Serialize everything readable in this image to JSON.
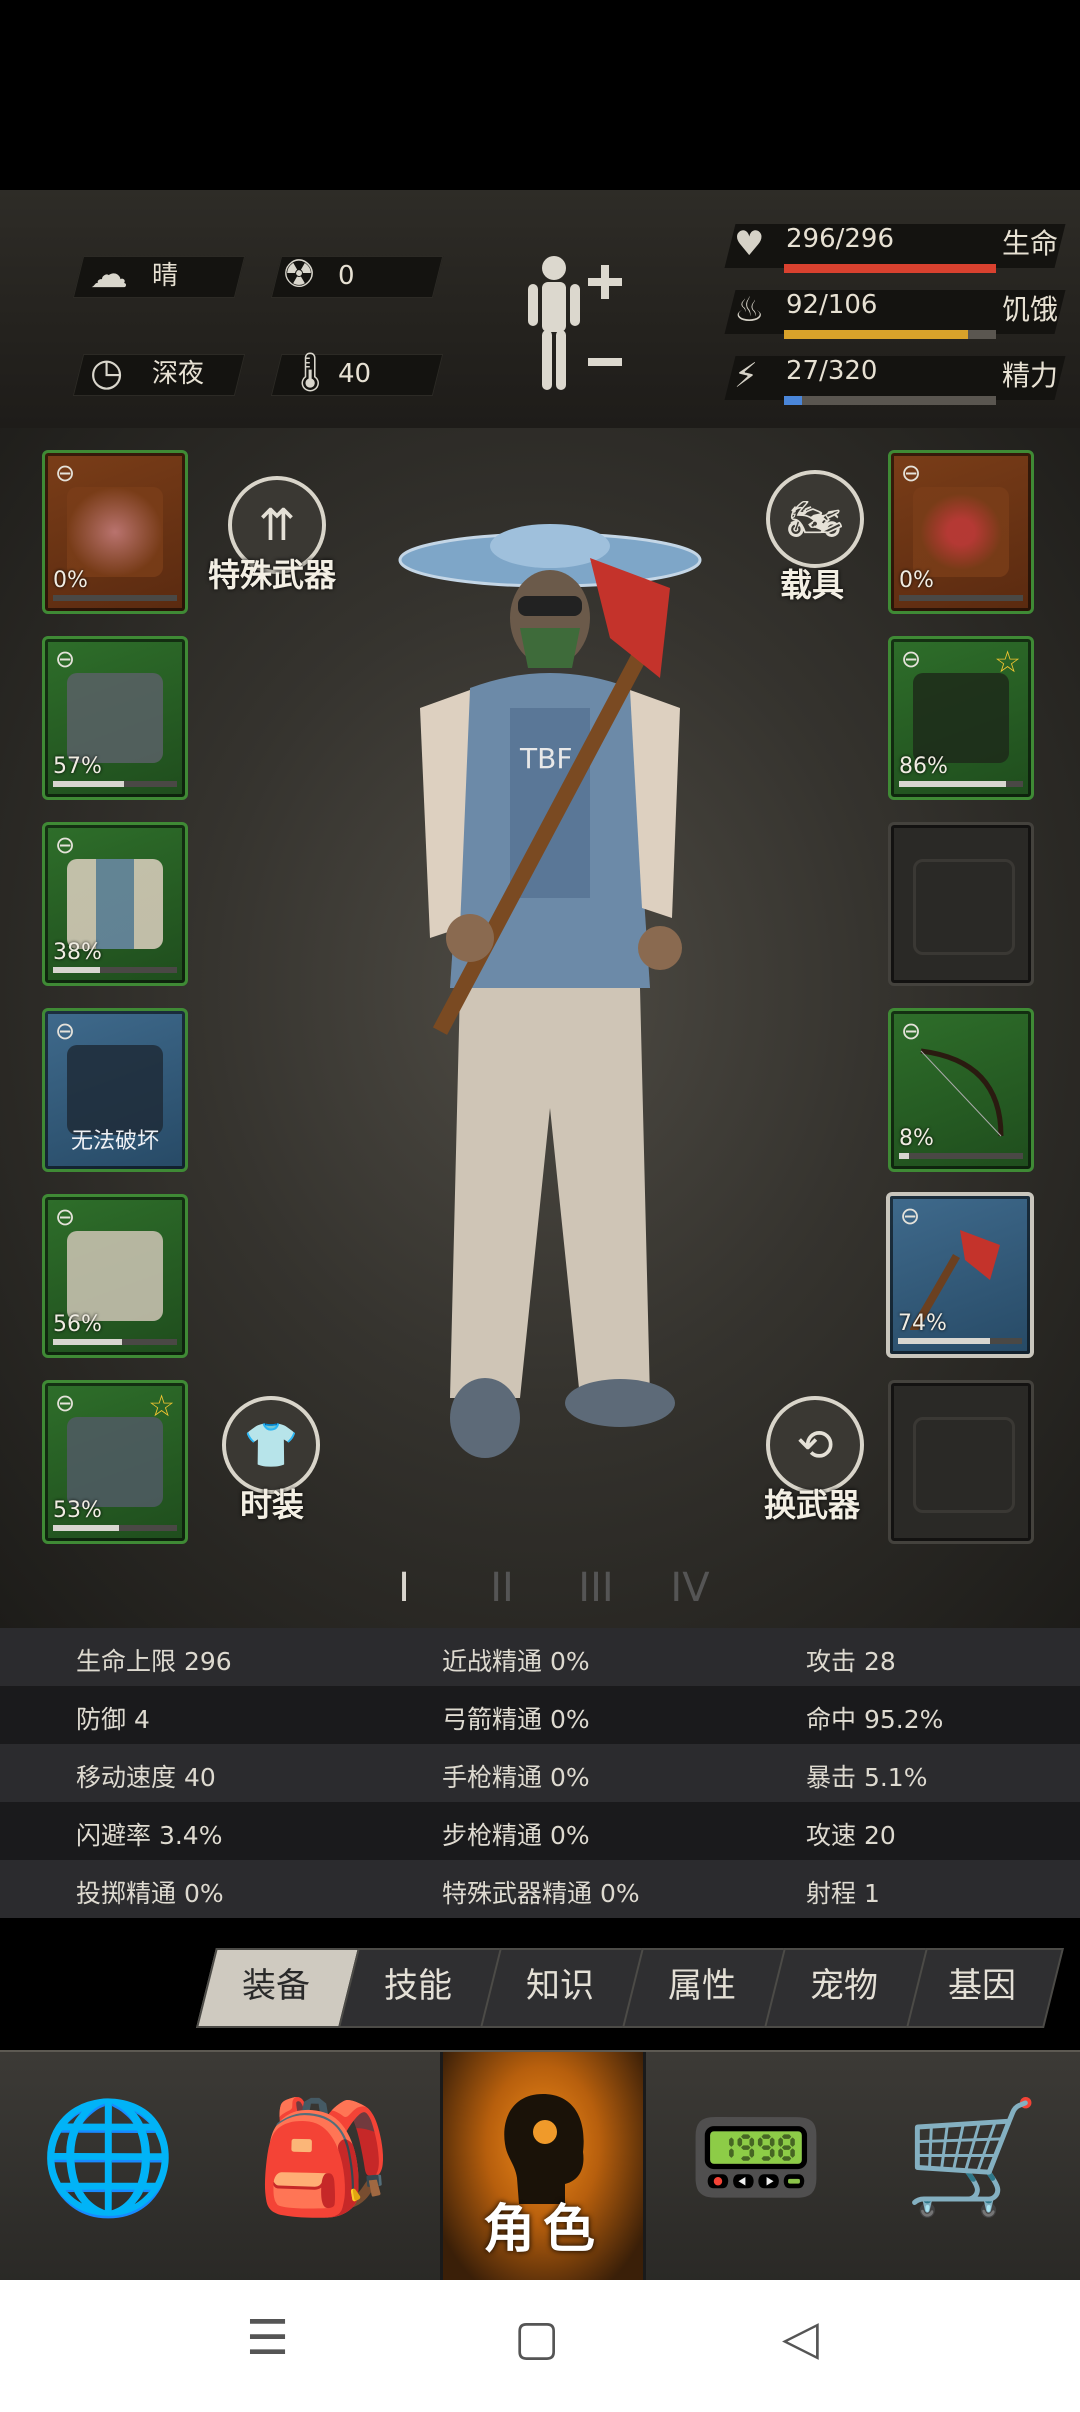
{
  "status": {
    "weather": "晴",
    "radiation": "0",
    "time_of_day": "深夜",
    "temperature": "40"
  },
  "vitals": [
    {
      "value": "296/296",
      "name": "生命",
      "fill": 1.0,
      "color": "#d9412f",
      "icon": "heart-icon"
    },
    {
      "value": "92/106",
      "name": "饥饿",
      "fill": 0.868,
      "color": "#d9a22a",
      "icon": "stomach-icon"
    },
    {
      "value": "27/320",
      "name": "精力",
      "fill": 0.084,
      "color": "#4a86d9",
      "icon": "energy-icon"
    }
  ],
  "left_slots": [
    {
      "type": "hat",
      "pct": "0%",
      "fill": 0.0
    },
    {
      "type": "shirt",
      "pct": "57%",
      "fill": 0.57
    },
    {
      "type": "jacket",
      "pct": "38%",
      "fill": 0.38
    },
    {
      "type": "backpack",
      "note": "无法破坏"
    },
    {
      "type": "pants",
      "pct": "56%",
      "fill": 0.56
    },
    {
      "type": "shoes",
      "pct": "53%",
      "fill": 0.53
    }
  ],
  "right_slots": [
    {
      "type": "glasses",
      "pct": "0%",
      "fill": 0.0
    },
    {
      "type": "mask",
      "pct": "86%",
      "fill": 0.86
    },
    {
      "type": "empty-bag"
    },
    {
      "type": "bow",
      "pct": "8%",
      "fill": 0.08
    },
    {
      "type": "axe",
      "pct": "74%",
      "fill": 0.74
    },
    {
      "type": "empty-bottle"
    }
  ],
  "buttons": {
    "special_weapon": "特殊武器",
    "vehicle": "载具",
    "fashion": "时装",
    "switch_weapon": "换武器"
  },
  "outfit_tabs": [
    "I",
    "II",
    "III",
    "IV"
  ],
  "stats": [
    [
      "生命上限 296",
      "近战精通 0%",
      "攻击 28"
    ],
    [
      "防御 4",
      "弓箭精通 0%",
      "命中 95.2%"
    ],
    [
      "移动速度 40",
      "手枪精通 0%",
      "暴击 5.1%"
    ],
    [
      "闪避率 3.4%",
      "步枪精通 0%",
      "攻速 20"
    ],
    [
      "投掷精通 0%",
      "特殊武器精通 0%",
      "射程 1"
    ]
  ],
  "tabs": [
    "装备",
    "技能",
    "知识",
    "属性",
    "宠物",
    "基因"
  ],
  "nav": {
    "character_label": "角色"
  },
  "colors": {
    "accent_orange": "#f08a1a",
    "slot_green": "#2e6e2a",
    "star": "#f3c531"
  }
}
